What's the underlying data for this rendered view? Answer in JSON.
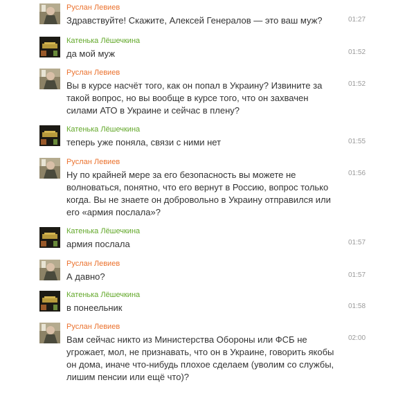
{
  "colors": {
    "ruslan_name": "#eb722e",
    "katenka_name": "#63a82a",
    "message_text": "#333333",
    "timestamp": "#9a9a9a"
  },
  "messages": [
    {
      "author": "Руслан Левиев",
      "avatar_icon": "ruslan-photo-avatar",
      "text": "Здравствуйте! Скажите, Алексей Генералов — это ваш муж?",
      "time": "01:27"
    },
    {
      "author": "Катенька Лёшечкина",
      "avatar_icon": "katenka-dark-avatar",
      "text": "да мой муж",
      "time": "01:52"
    },
    {
      "author": "Руслан Левиев",
      "avatar_icon": "ruslan-photo-avatar",
      "text": "Вы в курсе насчёт того, как он попал в Украину? Извините за такой вопрос, но вы вообще в курсе того, что он захвачен силами АТО в Украине и сейчас в плену?",
      "time": "01:52"
    },
    {
      "author": "Катенька Лёшечкина",
      "avatar_icon": "katenka-dark-avatar",
      "text": "теперь уже поняла, связи с ними нет",
      "time": "01:55"
    },
    {
      "author": "Руслан Левиев",
      "avatar_icon": "ruslan-photo-avatar",
      "text": "Ну по крайней мере за его безопасность вы можете не волноваться, понятно, что его вернут в Россию, вопрос только когда. Вы не знаете он добровольно в Украину отправился или его «армия послала»?",
      "time": "01:56"
    },
    {
      "author": "Катенька Лёшечкина",
      "avatar_icon": "katenka-dark-avatar",
      "text": "армия послала",
      "time": "01:57"
    },
    {
      "author": "Руслан Левиев",
      "avatar_icon": "ruslan-photo-avatar",
      "text": "А давно?",
      "time": "01:57"
    },
    {
      "author": "Катенька Лёшечкина",
      "avatar_icon": "katenka-dark-avatar",
      "text": "в понеельник",
      "time": "01:58"
    },
    {
      "author": "Руслан Левиев",
      "avatar_icon": "ruslan-photo-avatar",
      "text": "Вам сейчас никто из Министерства Обороны или ФСБ не угрожает, мол, не признавать, что он в Украине, говорить якобы он дома, иначе что-нибудь плохое сделаем (уволим со службы, лишим пенсии или ещё что)?",
      "time": "02:00"
    }
  ]
}
